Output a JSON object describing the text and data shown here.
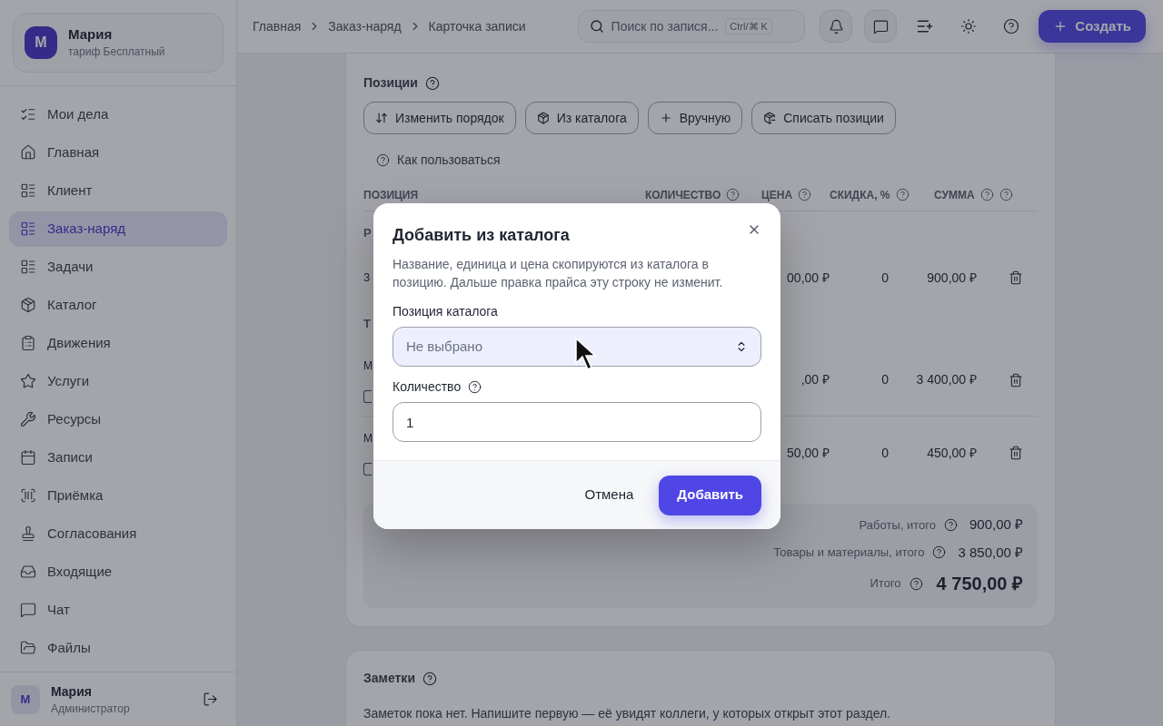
{
  "sidebar": {
    "profile": {
      "initial": "М",
      "name": "Мария",
      "plan": "тариф Бесплатный"
    },
    "items": [
      {
        "label": "Мои дела",
        "selected": false
      },
      {
        "label": "Главная",
        "selected": false
      },
      {
        "label": "Клиент",
        "selected": false
      },
      {
        "label": "Заказ-наряд",
        "selected": true
      },
      {
        "label": "Задачи",
        "selected": false
      },
      {
        "label": "Каталог",
        "selected": false
      },
      {
        "label": "Движения",
        "selected": false
      },
      {
        "label": "Услуги",
        "selected": false
      },
      {
        "label": "Ресурсы",
        "selected": false
      },
      {
        "label": "Записи",
        "selected": false
      },
      {
        "label": "Приёмка",
        "selected": false
      },
      {
        "label": "Согласования",
        "selected": false
      },
      {
        "label": "Входящие",
        "selected": false
      },
      {
        "label": "Чат",
        "selected": false
      },
      {
        "label": "Файлы",
        "selected": false
      }
    ],
    "user": {
      "initial": "М",
      "name": "Мария",
      "role": "Администратор"
    }
  },
  "breadcrumbs": [
    "Главная",
    "Заказ-наряд",
    "Карточка записи"
  ],
  "search": {
    "placeholder": "Поиск по запися...",
    "shortcut": "Ctrl/⌘ K"
  },
  "create_button": "Создать",
  "positions": {
    "title": "Позиции",
    "actions": [
      "Изменить порядок",
      "Из каталога",
      "Вручную",
      "Списать позиции"
    ],
    "help_link": "Как пользоваться",
    "columns": [
      {
        "label": "ПОЗИЦИЯ"
      },
      {
        "label": "КОЛИЧЕСТВО",
        "help": true
      },
      {
        "label": "ЦЕНА",
        "help": true
      },
      {
        "label": "СКИДКА, %",
        "help": true
      },
      {
        "label": "СУММА",
        "help": true
      }
    ],
    "rows": [
      {
        "kind": "group",
        "label": "Р"
      },
      {
        "kind": "item",
        "name": "З",
        "price": "00,00 ₽",
        "discount": "0",
        "sum": "900,00 ₽"
      },
      {
        "kind": "group",
        "label": "Т"
      },
      {
        "kind": "item",
        "name": "М",
        "checked": false,
        "price": ",00 ₽",
        "discount": "0",
        "sum": "3 400,00 ₽"
      },
      {
        "kind": "item",
        "name": "М",
        "checked": false,
        "price": "50,00 ₽",
        "discount": "0",
        "sum": "450,00 ₽"
      }
    ],
    "totals": [
      {
        "kind": "subtotal",
        "label": "Работы, итого",
        "value": "900,00 ₽"
      },
      {
        "kind": "subtotal",
        "label": "Товары и материалы, итого",
        "value": "3 850,00 ₽"
      },
      {
        "kind": "total",
        "label": "Итого",
        "value": "4 750,00 ₽"
      }
    ]
  },
  "notes": {
    "title": "Заметки",
    "empty_text": "Заметок пока нет. Напишите первую — её увидят коллеги, у которых открыт этот раздел."
  },
  "dialog": {
    "title": "Добавить из каталога",
    "description": "Название, единица и цена скопируются из каталога в позицию. Дальше правка прайса эту строку не изменит.",
    "fields": [
      {
        "kind": "select",
        "label": "Позиция каталога",
        "placeholder": "Не выбрано"
      },
      {
        "kind": "number",
        "label": "Количество",
        "value": "1",
        "help": true
      }
    ],
    "cancel": "Отмена",
    "submit": "Добавить"
  }
}
